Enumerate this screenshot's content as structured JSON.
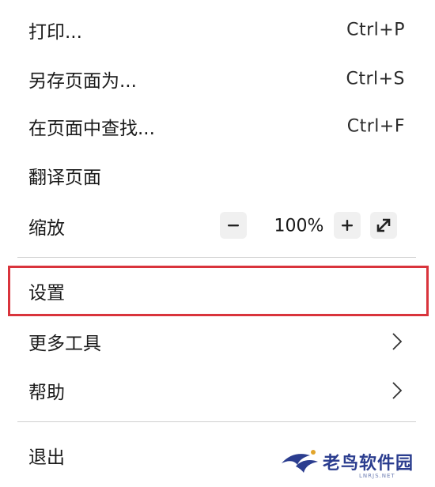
{
  "menu": {
    "items": [
      {
        "label": "打印...",
        "shortcut": "Ctrl+P"
      },
      {
        "label": "另存页面为...",
        "shortcut": "Ctrl+S"
      },
      {
        "label": "在页面中查找...",
        "shortcut": "Ctrl+F"
      },
      {
        "label": "翻译页面"
      }
    ],
    "zoom": {
      "label": "缩放",
      "value": "100%",
      "decrease_icon": "minus-icon",
      "increase_icon": "plus-icon",
      "fullscreen_icon": "fullscreen-icon"
    },
    "settings": {
      "label": "设置"
    },
    "more_tools": {
      "label": "更多工具",
      "icon": "chevron-right-icon"
    },
    "help": {
      "label": "帮助",
      "icon": "chevron-right-icon"
    },
    "exit": {
      "label": "退出"
    }
  },
  "highlight_color": "#d9343c",
  "watermark": {
    "text": "老鸟软件园",
    "sub": "LNRJS.NET",
    "logo_icon": "bird-logo-icon",
    "color": "#2b3d8f"
  }
}
